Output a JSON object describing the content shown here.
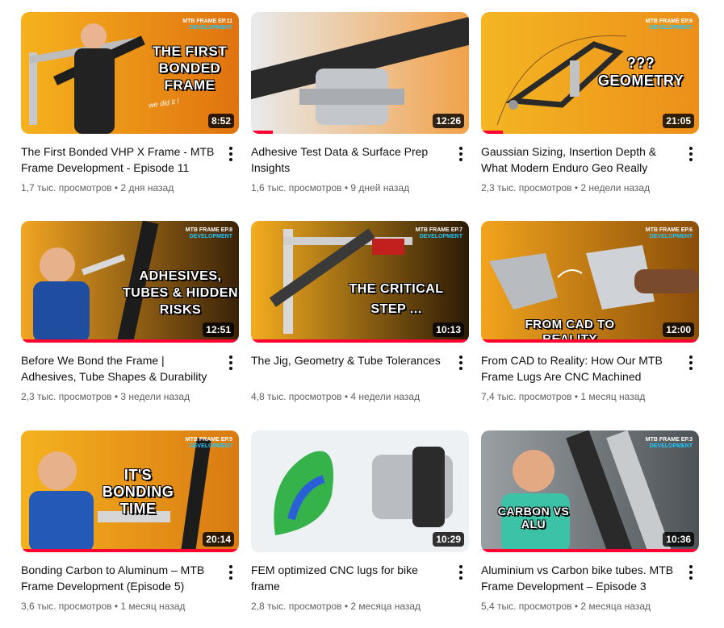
{
  "videos": [
    {
      "title": "The First Bonded VHP X Frame - MTB Frame Development - Episode 11",
      "views": "1,7 тыс. просмотров",
      "age": "2 дня назад",
      "duration": "8:52",
      "tag_line1": "MTB FRAME EP.11",
      "tag_line2": "DEVELOPMENT",
      "headline": "THE FIRST BONDED FRAME",
      "caption": "we did it !",
      "progress": 0.0
    },
    {
      "title": "Adhesive Test Data & Surface Prep Insights",
      "views": "1,6 тыс. просмотров",
      "age": "9 дней назад",
      "duration": "12:26",
      "progress": 0.1
    },
    {
      "title": "Gaussian Sizing, Insertion Depth & What Modern Enduro Geo Really Nee…",
      "views": "2,3 тыс. просмотров",
      "age": "2 недели назад",
      "duration": "21:05",
      "tag_line1": "MTB FRAME EP.9",
      "tag_line2": "DEVELOPMENT",
      "headline": "??? GEOMETRY",
      "progress": 0.1
    },
    {
      "title": "Before We Bond the Frame | Adhesives, Tube Shapes & Durability",
      "views": "2,3 тыс. просмотров",
      "age": "3 недели назад",
      "duration": "12:51",
      "tag_line1": "MTB FRAME EP.8",
      "tag_line2": "DEVELOPMENT",
      "headline": "ADHESIVES, TUBES & HIDDEN RISKS",
      "progress": 1.0
    },
    {
      "title": "The Jig, Geometry & Tube Tolerances",
      "views": "4,8 тыс. просмотров",
      "age": "4 недели назад",
      "duration": "10:13",
      "tag_line1": "MTB FRAME EP.7",
      "tag_line2": "DEVELOPMENT",
      "headline": "THE CRITICAL STEP ...",
      "progress": 1.0
    },
    {
      "title": "From CAD to Reality: How Our MTB Frame Lugs Are CNC Machined",
      "views": "7,4 тыс. просмотров",
      "age": "1 месяц назад",
      "duration": "12:00",
      "tag_line1": "MTB FRAME EP.6",
      "tag_line2": "DEVELOPMENT",
      "headline": "FROM CAD TO REALITY",
      "progress": 1.0
    },
    {
      "title": "Bonding Carbon to Aluminum – MTB Frame Development (Episode 5)",
      "views": "3,6 тыс. просмотров",
      "age": "1 месяц назад",
      "duration": "20:14",
      "tag_line1": "MTB FRAME EP.5",
      "tag_line2": "DEVELOPMENT",
      "headline": "IT'S BONDING TIME",
      "progress": 1.0
    },
    {
      "title": "FEM optimized CNC lugs for bike frame",
      "views": "2,8 тыс. просмотров",
      "age": "2 месяца назад",
      "duration": "10:29",
      "progress": 0.0
    },
    {
      "title": "Aluminium vs Carbon bike tubes. MTB Frame Development – Episode 3",
      "views": "5,4 тыс. просмотров",
      "age": "2 месяца назад",
      "duration": "10:36",
      "tag_line1": "MTB FRAME EP.3",
      "tag_line2": "DEVELOPMENT",
      "headline": "CARBON VS ALU",
      "progress": 1.0
    }
  ],
  "colors": {
    "progress": "#ff0033",
    "orange": "#f2a01a",
    "meta": "#606060"
  },
  "icons": {
    "menu": "more-vert-icon"
  }
}
